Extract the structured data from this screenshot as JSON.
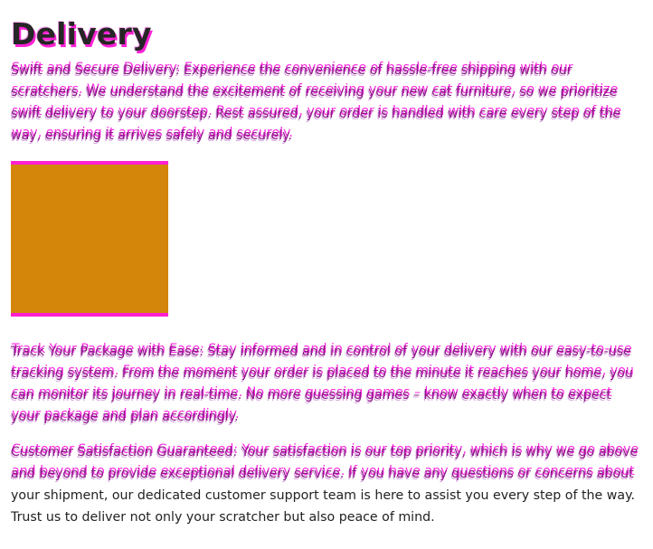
{
  "page": {
    "title": "Delivery",
    "intro": "Swift and Secure Delivery: Experience the convenience of hassle-free shipping with our scratchers. We understand the excitement of receiving your new cat furniture, so we prioritize swift delivery to your doorstep. Rest assured, your order is handled with care every step of the way, ensuring it arrives safely and securely.",
    "tracking": "Track Your Package with Ease: Stay informed and in control of your delivery with our easy-to-use tracking system. From the moment your order is placed to the minute it reaches your home, you can monitor its journey in real-time. No more guessing games – know exactly when to expect your package and plan accordingly.",
    "satisfaction_glitched": "Customer Satisfaction Guaranteed: Your satisfaction is our top priority, which is why we go above and beyond to provide exceptional delivery service. If you have any questions or concerns about",
    "satisfaction_clean": "your shipment, our dedicated customer support team is here to assist you every step of the way. Trust us to deliver not only your scratcher but also peace of mind."
  },
  "colors": {
    "accent_magenta": "#ff1fcf",
    "image_fill": "#d4860b"
  }
}
